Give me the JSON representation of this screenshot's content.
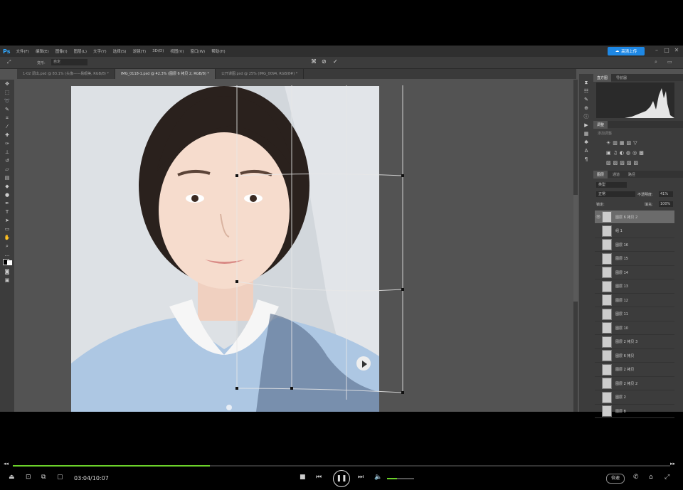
{
  "app": {
    "logo": "Ps",
    "menu": [
      "文件(F)",
      "编辑(E)",
      "图像(I)",
      "图层(L)",
      "文字(Y)",
      "选择(S)",
      "滤镜(T)",
      "3D(D)",
      "视图(V)",
      "窗口(W)",
      "帮助(H)"
    ],
    "cloud_button": "高清上传"
  },
  "options_bar": {
    "mode_label": "变形:",
    "mode_value": "自定"
  },
  "tabs": [
    {
      "label": "1-02 调出.psd @ 83.1% (头像——易眼美, RGB/8) *",
      "active": false
    },
    {
      "label": "IMG_0118-1.psd @ 42.3% (图层 6 拷贝 2, RGB/8) *",
      "active": true
    },
    {
      "label": "公开课图.psd @ 25% (IMG_0094, RGB/8#) *",
      "active": false
    }
  ],
  "panels": {
    "histogram_tabs": [
      "直方图",
      "导航器"
    ],
    "adjust_tab": "调整",
    "adjust_hint": "添加调整",
    "layers_tabs": [
      "图层",
      "通道",
      "路径"
    ],
    "kind_filter": "类型",
    "blend_mode": "正常",
    "opacity_label": "不透明度:",
    "opacity_value": "41%",
    "lock_label": "锁定:",
    "fill_label": "填充:",
    "fill_value": "100%"
  },
  "layers": [
    {
      "name": "图层 6 拷贝 2",
      "selected": true
    },
    {
      "name": "组 1",
      "selected": false
    },
    {
      "name": "图层 16",
      "selected": false
    },
    {
      "name": "图层 15",
      "selected": false
    },
    {
      "name": "图层 14",
      "selected": false
    },
    {
      "name": "图层 13",
      "selected": false
    },
    {
      "name": "图层 12",
      "selected": false
    },
    {
      "name": "图层 11",
      "selected": false
    },
    {
      "name": "图层 10",
      "selected": false
    },
    {
      "name": "图层 2 拷贝 3",
      "selected": false
    },
    {
      "name": "图层 6 拷贝",
      "selected": false
    },
    {
      "name": "图层 2 拷贝",
      "selected": false
    },
    {
      "name": "图层 2 拷贝 2",
      "selected": false
    },
    {
      "name": "图层 2",
      "selected": false
    },
    {
      "name": "图层 8",
      "selected": false
    }
  ],
  "player": {
    "timecode": "03:04/10:07",
    "progress": 0.3,
    "volume": 0.37,
    "speed_label": "倍速"
  },
  "colors": {
    "accent_green": "#6bd12a",
    "ps_blue": "#31a8ff"
  }
}
